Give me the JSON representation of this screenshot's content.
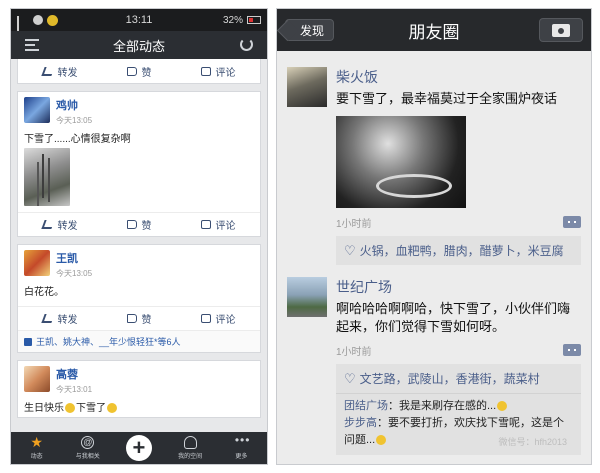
{
  "left": {
    "status": {
      "time": "13:11",
      "battery": "32%"
    },
    "header": {
      "title": "全部动态"
    },
    "top_actions": {
      "share": "转发",
      "like": "赞",
      "comment": "评论"
    },
    "posts": [
      {
        "name": "鸡帅",
        "time": "今天13:05",
        "text": "下雪了......心情很复杂啊",
        "actions": {
          "share": "转发",
          "like": "赞",
          "comment": "评论"
        }
      },
      {
        "name": "王凯",
        "time": "今天13:05",
        "text": "白花花。",
        "actions": {
          "share": "转发",
          "like": "赞",
          "comment": "评论"
        },
        "likes": "王凯、姚大神、__年少恨轻狂*等6人"
      },
      {
        "name": "高蓉",
        "time": "今天13:01",
        "text_a": "生日快乐",
        "text_b": "下雪了"
      }
    ],
    "tabs": {
      "feed": "动态",
      "mentions": "与我相关",
      "plus": "+",
      "profile": "我的空间",
      "more": "更多"
    }
  },
  "right": {
    "header": {
      "back": "发现",
      "title": "朋友圈"
    },
    "moments": [
      {
        "name": "柴火饭",
        "text": "要下雪了，最幸福莫过于全家围炉夜话",
        "time": "1小时前",
        "likes": "火锅，血粑鸭，腊肉，醋萝卜，米豆腐"
      },
      {
        "name": "世纪广场",
        "text": "啊哈哈哈啊啊哈，快下雪了，小伙伴们嗨起来，你们觉得下雪如何呀。",
        "time": "1小时前",
        "likes": "文艺路，武陵山，香港街，蔬菜村",
        "comments": [
          {
            "name": "团结广场",
            "text": "我是来刷存在感的..."
          },
          {
            "name": "步步高",
            "text": "要不要打折，欢庆找下雪呢，这是个问题..."
          }
        ]
      }
    ],
    "watermark": "微信号：hfh2013"
  }
}
